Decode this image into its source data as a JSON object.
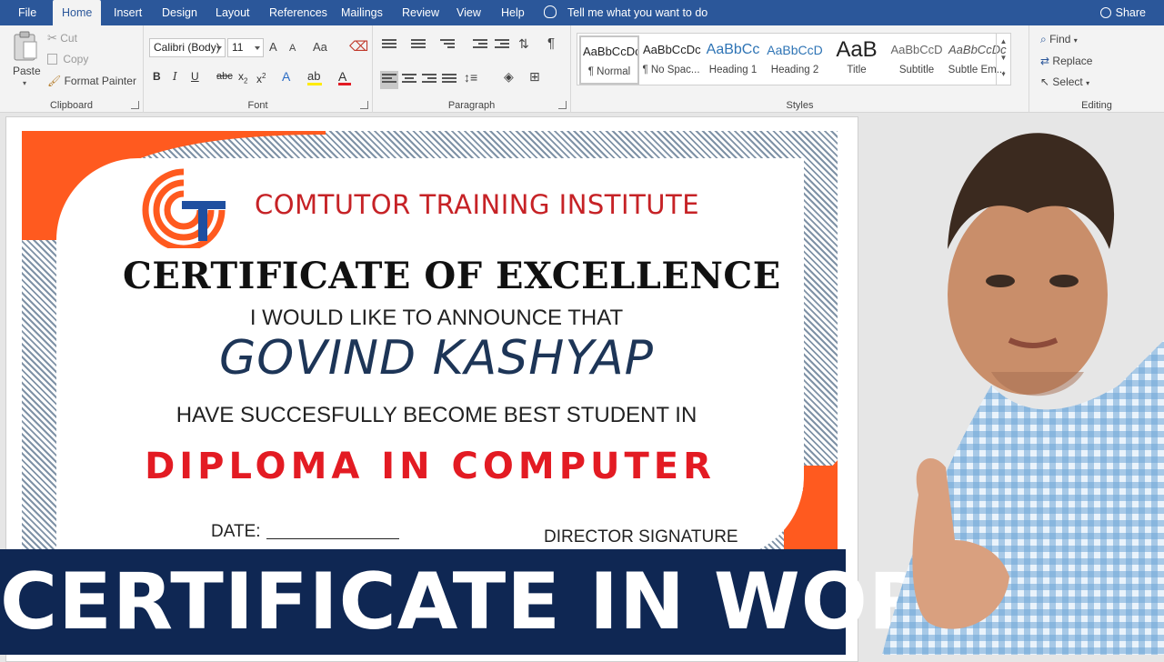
{
  "tabs": [
    {
      "label": "File"
    },
    {
      "label": "Home"
    },
    {
      "label": "Insert"
    },
    {
      "label": "Design"
    },
    {
      "label": "Layout"
    },
    {
      "label": "References"
    },
    {
      "label": "Mailings"
    },
    {
      "label": "Review"
    },
    {
      "label": "View"
    },
    {
      "label": "Help"
    }
  ],
  "tell_me": "Tell me what you want to do",
  "share": "Share",
  "clipboard": {
    "paste": "Paste",
    "cut": "Cut",
    "copy": "Copy",
    "format_painter": "Format Painter",
    "group_label": "Clipboard"
  },
  "font": {
    "family": "Calibri (Body)",
    "size": "11",
    "grow": "A",
    "shrink": "A",
    "change_case": "Aa",
    "bold": "B",
    "italic": "I",
    "underline": "U",
    "strike": "abc",
    "subscript": "x",
    "superscript": "x",
    "text_effects": "A",
    "font_color": "A",
    "group_label": "Font"
  },
  "paragraph": {
    "show_marks": "¶",
    "group_label": "Paragraph"
  },
  "styles": {
    "items": [
      {
        "sample": "AaBbCcDc",
        "name": "¶ Normal"
      },
      {
        "sample": "AaBbCcDc",
        "name": "¶ No Spac..."
      },
      {
        "sample": "AaBbCc",
        "name": "Heading 1"
      },
      {
        "sample": "AaBbCcD",
        "name": "Heading 2"
      },
      {
        "sample": "AaB",
        "name": "Title"
      },
      {
        "sample": "AaBbCcD",
        "name": "Subtitle"
      },
      {
        "sample": "AaBbCcDc",
        "name": "Subtle Em..."
      }
    ],
    "group_label": "Styles"
  },
  "editing": {
    "find": "Find",
    "replace": "Replace",
    "select": "Select",
    "group_label": "Editing"
  },
  "certificate": {
    "institute": "COMTUTOR TRAINING INSTITUTE",
    "title": "CERTIFICATE OF EXCELLENCE",
    "announce": "I WOULD LIKE TO ANNOUNCE THAT",
    "name": "GOVIND KASHYAP",
    "achievement": "HAVE SUCCESFULLY BECOME BEST STUDENT IN",
    "course": "DIPLOMA IN COMPUTER",
    "date_label": "DATE:",
    "signature_label": "DIRECTOR SIGNATURE"
  },
  "banner": "CERTIFICATE IN WORD",
  "colors": {
    "ribbon_blue": "#2b579a",
    "cert_orange": "#ff5a1f",
    "institute_red": "#c62226",
    "course_red": "#e31b23",
    "name_navy": "#1d3557",
    "banner_navy": "#0f2753"
  }
}
